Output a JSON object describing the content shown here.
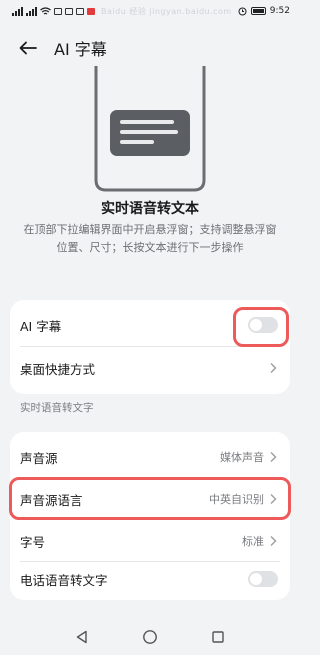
{
  "status_bar": {
    "time": "9:52",
    "watermark": "Baidu 经验 jingyan.baidu.com"
  },
  "header": {
    "title": "AI 字幕"
  },
  "hero": {
    "title": "实时语音转文本",
    "description": "在顶部下拉编辑界面中开启悬浮窗；支持调整悬浮窗位置、尺寸；长按文本进行下一步操作"
  },
  "card1": {
    "ai_caption_label": "AI 字幕",
    "ai_caption_enabled": false,
    "desktop_shortcut_label": "桌面快捷方式"
  },
  "section_label": "实时语音转文字",
  "card2": {
    "audio_source_label": "声音源",
    "audio_source_value": "媒体声音",
    "audio_source_language_label": "声音源语言",
    "audio_source_language_value": "中英自识别",
    "font_size_label": "字号",
    "font_size_value": "标准",
    "phone_voice_label": "电话语音转文字",
    "phone_voice_enabled": false
  },
  "colors": {
    "background": "#f1f3f5",
    "card": "#ffffff",
    "highlight": "#ec5a5a",
    "toggle_off": "#dfe1e4"
  }
}
